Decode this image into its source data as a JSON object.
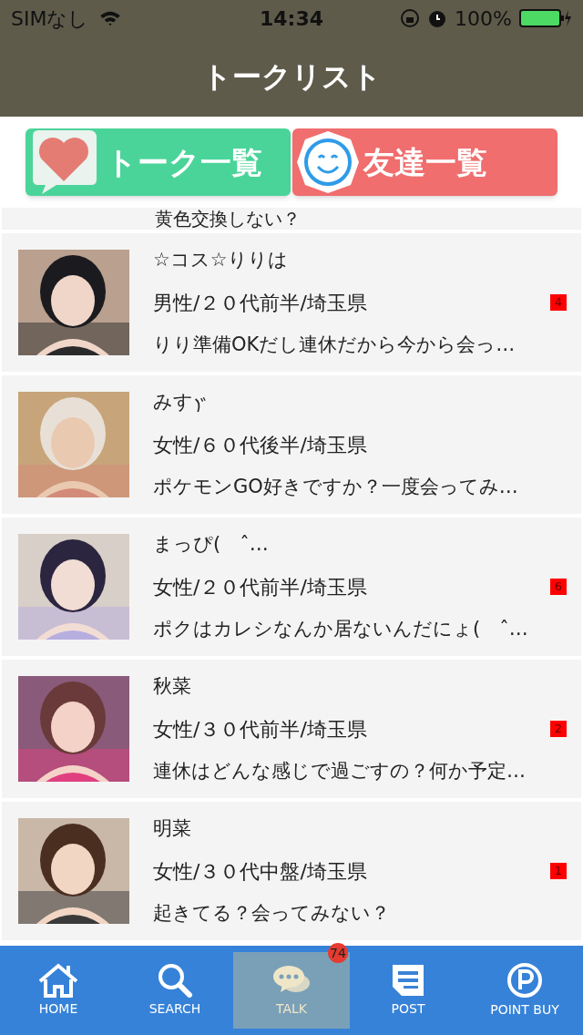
{
  "status_bar": {
    "carrier": "SIMなし",
    "time": "14:34",
    "battery": "100%"
  },
  "header": {
    "title": "トークリスト"
  },
  "switch_buttons": [
    {
      "label": "トーク一覧",
      "kind": "talk"
    },
    {
      "label": "友達一覧",
      "kind": "friends"
    }
  ],
  "partial_row": {
    "message": "黄色交換しない？"
  },
  "rows": [
    {
      "name": "☆コス☆りりは",
      "profile": "男性/２０代前半/埼玉県",
      "message": "りり準備OKだし連休だから今から会っ…",
      "unread": "4"
    },
    {
      "name": "みす",
      "iteration_mark": true,
      "profile": "女性/６０代後半/埼玉県",
      "message": "ポケモンGO好きですか？一度会ってみ…"
    },
    {
      "name": "まっぴ(　ˆ…",
      "profile": "女性/２０代前半/埼玉県",
      "message": "ポクはカレシなんか居ないんだにょ(　ˆ…",
      "unread": "6"
    },
    {
      "name": "秋菜",
      "profile": "女性/３０代前半/埼玉県",
      "message": "連休はどんな感じで過ごすの？何か予定…",
      "unread": "2"
    },
    {
      "name": "明菜",
      "profile": "女性/３０代中盤/埼玉県",
      "message": "起きてる？会ってみない？",
      "unread": "1"
    }
  ],
  "tab_bar": [
    {
      "label": "HOME",
      "kind": "home",
      "selected": false
    },
    {
      "label": "SEARCH",
      "kind": "search",
      "selected": false
    },
    {
      "label": "TALK",
      "kind": "talk",
      "selected": true,
      "badge": "74"
    },
    {
      "label": "POST",
      "kind": "post",
      "selected": false
    },
    {
      "label": "POINT BUY",
      "kind": "point",
      "selected": false
    }
  ]
}
